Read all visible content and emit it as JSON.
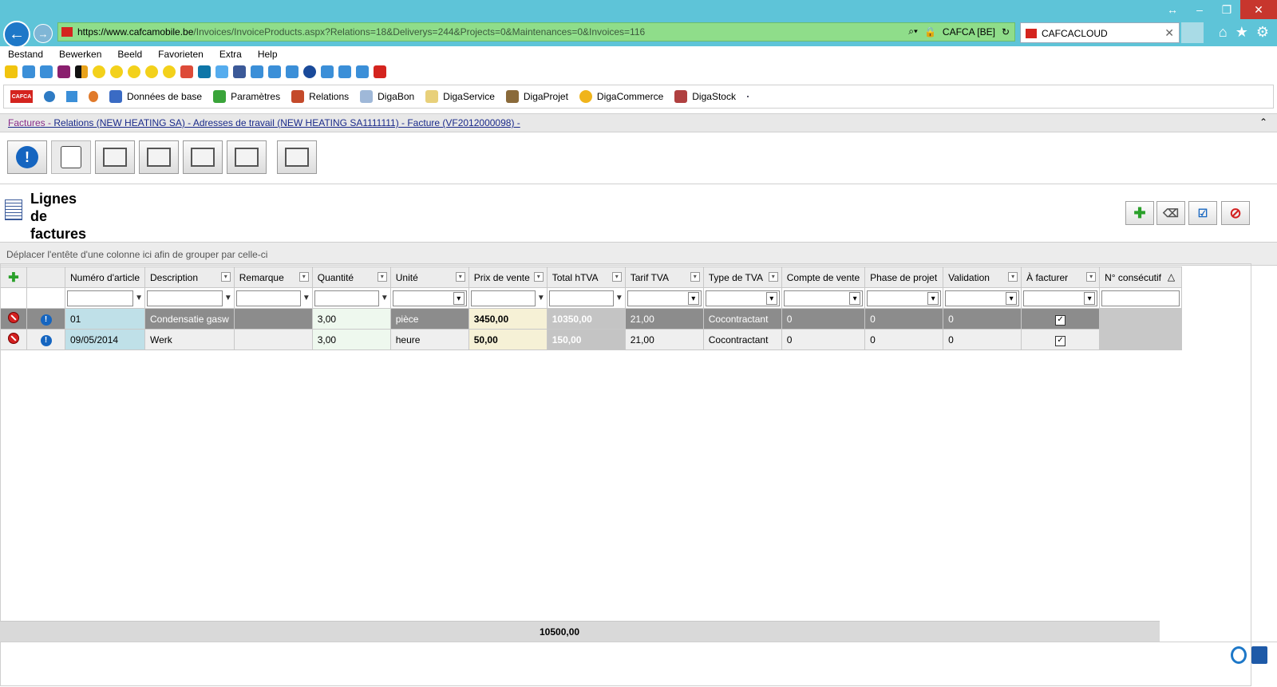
{
  "browser": {
    "url_scheme_host": "https://www.cafcamobile.be",
    "url_path": "/Invoices/InvoiceProducts.aspx?Relations=18&Deliverys=244&Projects=0&Maintenances=0&Invoices=116",
    "site_identity": "CAFCA [BE]",
    "tab_title": "CAFCACLOUD",
    "menu": [
      "Bestand",
      "Bewerken",
      "Beeld",
      "Favorieten",
      "Extra",
      "Help"
    ]
  },
  "apptoolbar": {
    "logo": "CAFCA",
    "items": [
      "Données de base",
      "Paramètres",
      "Relations",
      "DigaBon",
      "DigaService",
      "DigaProjet",
      "DigaCommerce",
      "DigaStock"
    ]
  },
  "breadcrumb": {
    "first": "Factures -",
    "rest": " Relations (NEW HEATING SA) - Adresses de travail (NEW HEATING SA1111111) - Facture (VF2012000098) -"
  },
  "section": {
    "title_line1": "Lignes",
    "title_line2": "de",
    "title_line3": "factures"
  },
  "grid": {
    "group_hint": "Déplacer l'entête d'une colonne ici afin de grouper par celle-ci",
    "columns": [
      "Numéro d'article",
      "Description",
      "Remarque",
      "Quantité",
      "Unité",
      "Prix de vente",
      "Total hTVA",
      "Tarif TVA",
      "Type de TVA",
      "Compte de vente",
      "Phase de projet",
      "Validation",
      "À facturer",
      "N° consécutif"
    ],
    "rows": [
      {
        "article": "01",
        "description": "Condensatie gasw",
        "remarque": "",
        "quantite": "3,00",
        "unite": "pièce",
        "prix": "3450,00",
        "total": "10350,00",
        "tarif": "21,00",
        "type": "Cocontractant",
        "compte": "0",
        "phase": "0",
        "validation": "0",
        "a_facturer": true,
        "consecutif": ""
      },
      {
        "article": "09/05/2014",
        "description": "Werk",
        "remarque": "",
        "quantite": "3,00",
        "unite": "heure",
        "prix": "50,00",
        "total": "150,00",
        "tarif": "21,00",
        "type": "Cocontractant",
        "compte": "0",
        "phase": "0",
        "validation": "0",
        "a_facturer": true,
        "consecutif": ""
      }
    ],
    "footer_total": "10500,00"
  },
  "colors": {
    "chrome": "#5ec4d8",
    "address_bar": "#8fdd8a",
    "accent_blue": "#1565c0",
    "delete_red": "#d32020"
  }
}
